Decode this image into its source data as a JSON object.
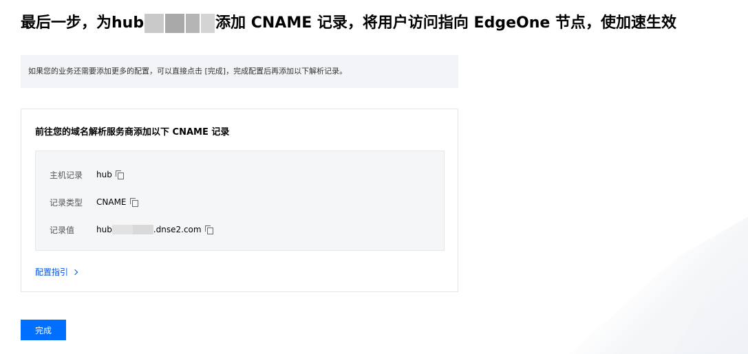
{
  "title": {
    "prefix": "最后一步，为hub",
    "suffix": "添加 CNAME 记录，将用户访问指向 EdgeOne 节点，使加速生效"
  },
  "notice": "如果您的业务还需要添加更多的配置，可以直接点击 [完成]，完成配置后再添加以下解析记录。",
  "card": {
    "title": "前往您的域名解析服务商添加以下 CNAME 记录",
    "records": [
      {
        "label": "主机记录",
        "value_prefix": "hub",
        "value_suffix": ""
      },
      {
        "label": "记录类型",
        "value_prefix": "CNAME",
        "value_suffix": ""
      },
      {
        "label": "记录值",
        "value_prefix": "hub",
        "value_suffix": ".dnse2.com"
      }
    ],
    "icons": {
      "copy": "copy-icon",
      "chevron": "chevron-right-icon"
    },
    "guide_link": "配置指引"
  },
  "done_button": "完成",
  "colors": {
    "primary": "#006eff",
    "link": "#0052d9"
  }
}
